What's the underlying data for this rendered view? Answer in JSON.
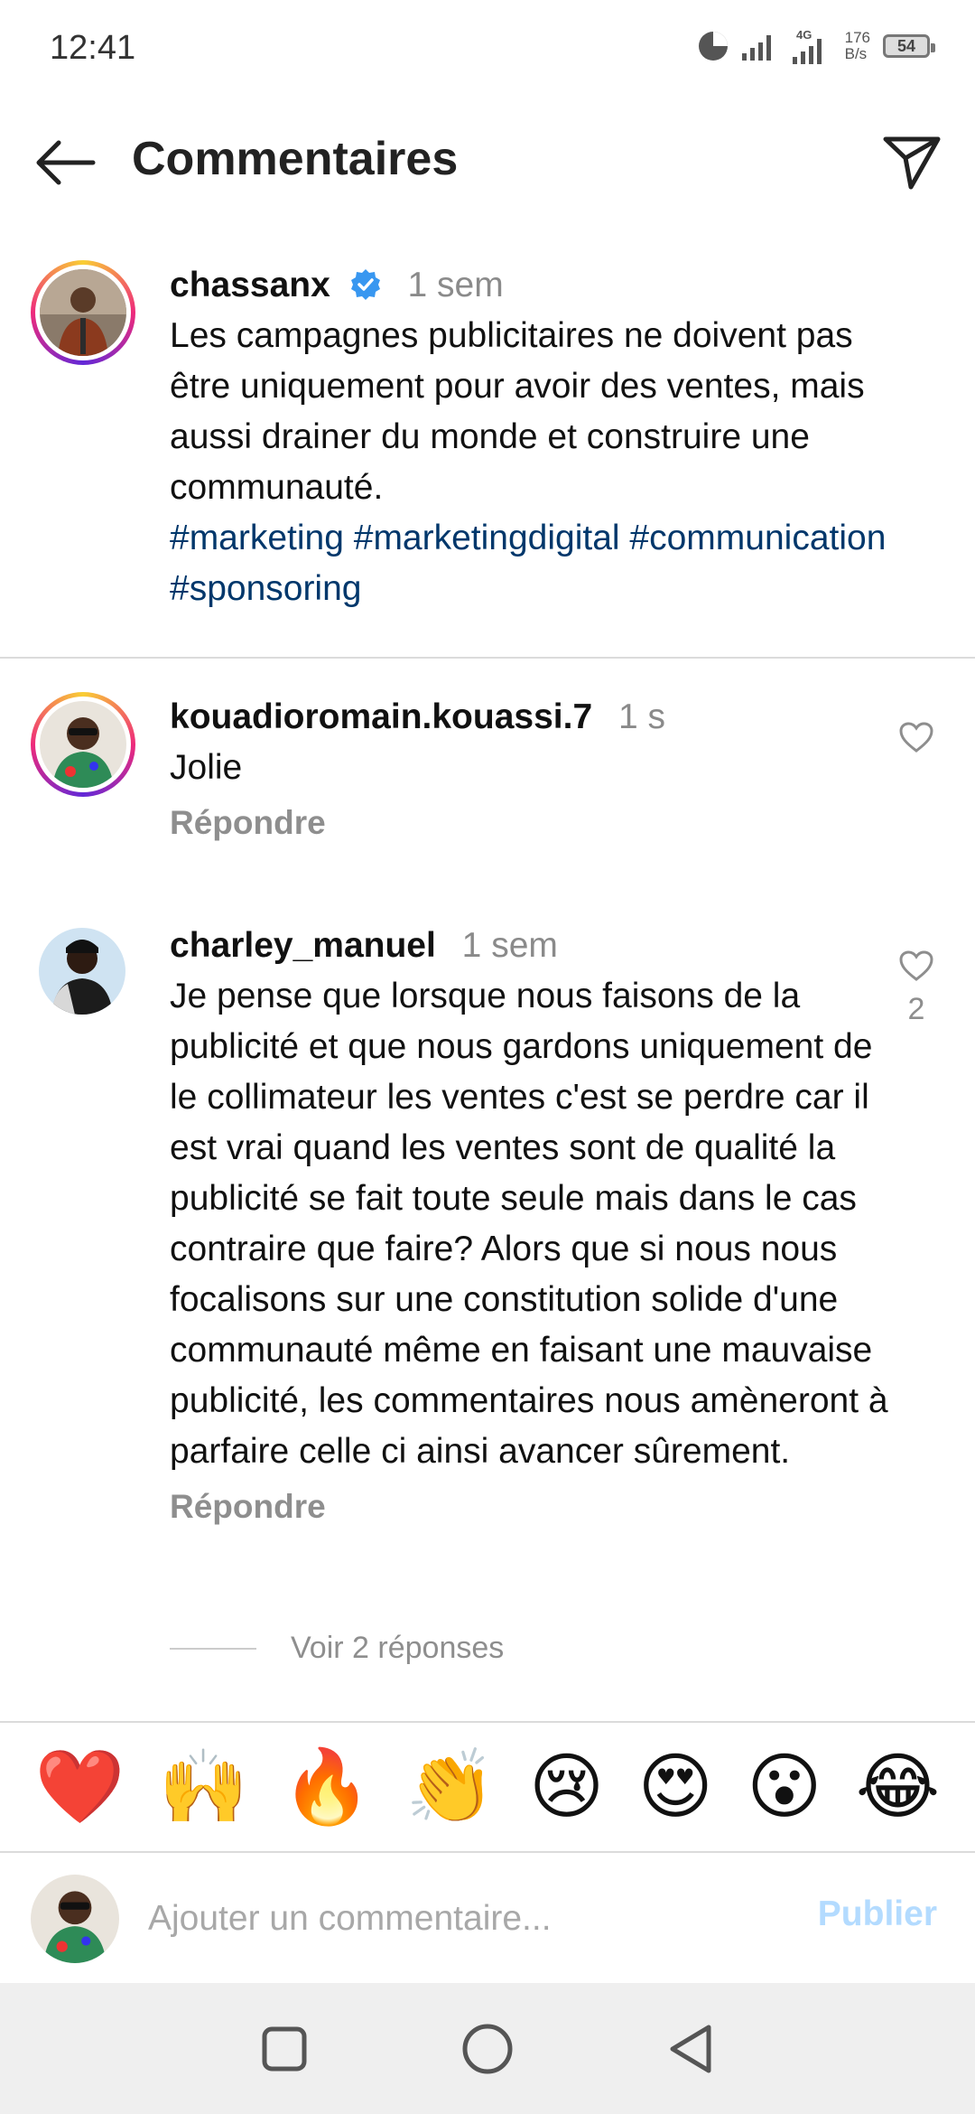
{
  "status_bar": {
    "time": "12:41",
    "network_label": "4G",
    "speed_value": "176",
    "speed_unit": "B/s",
    "battery": "54"
  },
  "header": {
    "title": "Commentaires",
    "back_icon": "arrow-left-icon",
    "share_icon": "paper-plane-icon"
  },
  "caption": {
    "username": "chassanx",
    "verified": true,
    "time": "1 sem",
    "text": "Les campagnes publicitaires ne doivent pas être uniquement pour avoir des ventes, mais aussi drainer du monde et construire une communauté.",
    "hashtags": "#marketing #marketingdigital #communication #sponsoring"
  },
  "comments": [
    {
      "username": "kouadioromain.kouassi.7",
      "time": "1 s",
      "text": "Jolie",
      "reply_label": "Répondre",
      "likes": ""
    },
    {
      "username": "charley_manuel",
      "time": "1 sem",
      "text": "Je pense que lorsque nous faisons de la publicité et que nous gardons uniquement de le collimateur les ventes c'est se perdre car il est vrai quand les ventes sont de qualité la publicité se fait toute seule mais dans le cas contraire que faire? Alors que si nous nous focalisons sur une constitution solide d'une communauté même en faisant une mauvaise publicité, les commentaires nous amèneront à parfaire celle ci ainsi avancer sûrement.",
      "reply_label": "Répondre",
      "likes": "2",
      "view_replies": "Voir 2 réponses"
    }
  ],
  "emoji_bar": [
    "❤️",
    "🙌",
    "🔥",
    "👏",
    "😢",
    "😍",
    "😮",
    "😂"
  ],
  "input": {
    "placeholder": "Ajouter un commentaire...",
    "publish_label": "Publier"
  },
  "colors": {
    "hashtag": "#00376b",
    "verified": "#3897f0",
    "publish_disabled": "#b3dbff",
    "muted": "#8e8e8e"
  }
}
